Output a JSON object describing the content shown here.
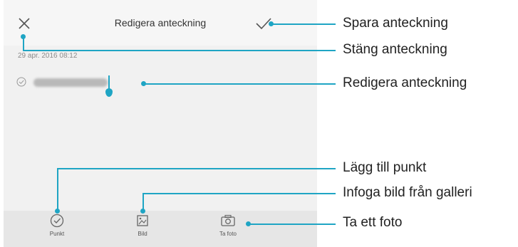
{
  "app": {
    "title": "Redigera anteckning",
    "date": "29 apr. 2016 08:12"
  },
  "toolbar": [
    {
      "label": "Punkt"
    },
    {
      "label": "Bild"
    },
    {
      "label": "Ta foto"
    }
  ],
  "callouts": {
    "save": "Spara anteckning",
    "close": "Stäng anteckning",
    "edit": "Redigera anteckning",
    "add_bullet": "Lägg till punkt",
    "insert_image": "Infoga bild från galleri",
    "take_photo": "Ta ett foto"
  },
  "colors": {
    "accent": "#1fa5c4"
  }
}
